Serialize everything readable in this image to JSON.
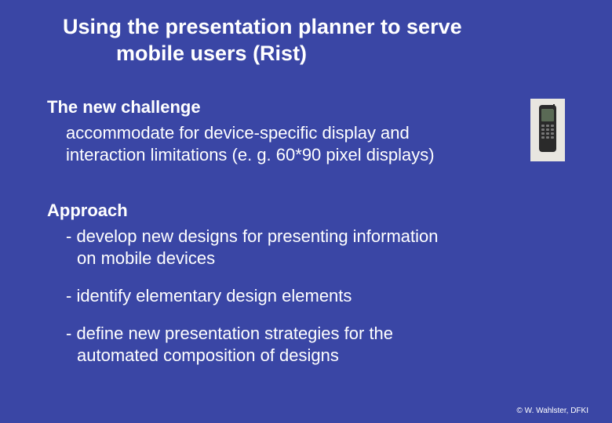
{
  "title_line1": "Using the presentation planner to serve",
  "title_line2": "mobile users  (Rist)",
  "challenge": {
    "heading": "The new challenge",
    "body_line1": "accommodate for device-specific display and",
    "body_line2": "interaction limitations (e. g. 60*90 pixel displays)"
  },
  "approach": {
    "heading": "Approach",
    "bullets": [
      {
        "l1": "- develop new designs for presenting information",
        "l2": "on mobile devices"
      },
      {
        "l1": "- identify elementary design elements",
        "l2": ""
      },
      {
        "l1": "- define new presentation strategies for the",
        "l2": "automated composition of designs"
      }
    ]
  },
  "footer": "© W. Wahlster, DFKI",
  "phone_icon_name": "mobile-phone-icon"
}
